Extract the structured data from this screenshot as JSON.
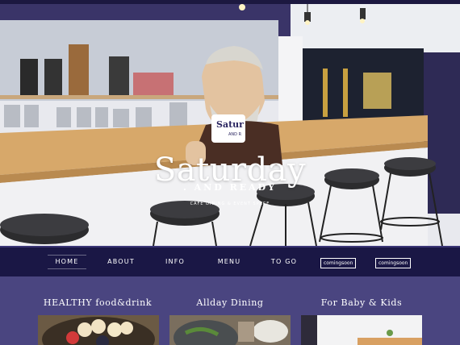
{
  "hero": {
    "title": "Saturday",
    "subtitle": ". AND READY",
    "tagline": "CAFE DINING & EVENT SPACE",
    "cup_text": "Satur",
    "cup_subtext": "AND R"
  },
  "nav": {
    "items": [
      "HOME",
      "ABOUT",
      "INFO",
      "MENU",
      "TO GO"
    ],
    "badges": [
      "comingsoon",
      "comingsoon"
    ]
  },
  "sections": {
    "titles": [
      "HEALTHY food&drink",
      "Allday Dining",
      "For Baby & Kids"
    ]
  },
  "colors": {
    "background": "#4a4580",
    "nav_background": "#1a1745",
    "text": "#ffffff"
  }
}
